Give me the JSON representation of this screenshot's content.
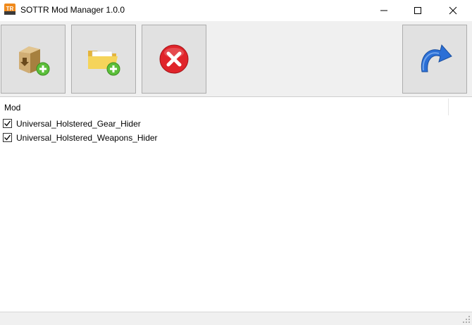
{
  "window": {
    "title": "SOTTR Mod Manager 1.0.0",
    "app_icon_text": "TR",
    "controls": [
      "minimize-icon",
      "maximize-icon",
      "close-icon"
    ]
  },
  "toolbar": {
    "buttons": [
      {
        "name": "add-archive-button",
        "icon": "package-add-icon"
      },
      {
        "name": "add-folder-button",
        "icon": "folder-add-icon"
      },
      {
        "name": "remove-button",
        "icon": "red-x-icon"
      },
      {
        "name": "refresh-button",
        "icon": "redo-arrow-icon"
      }
    ]
  },
  "mod_list": {
    "header": "Mod",
    "items": [
      {
        "label": "Universal_Holstered_Gear_Hider",
        "checked": true
      },
      {
        "label": "Universal_Holstered_Weapons_Hider",
        "checked": true
      }
    ]
  },
  "colors": {
    "toolbar_bg": "#f0f0f0",
    "button_bg": "#e1e1e1",
    "remove_red": "#e0242a",
    "add_green": "#5bbf3a",
    "refresh_blue": "#2b6fd6"
  }
}
